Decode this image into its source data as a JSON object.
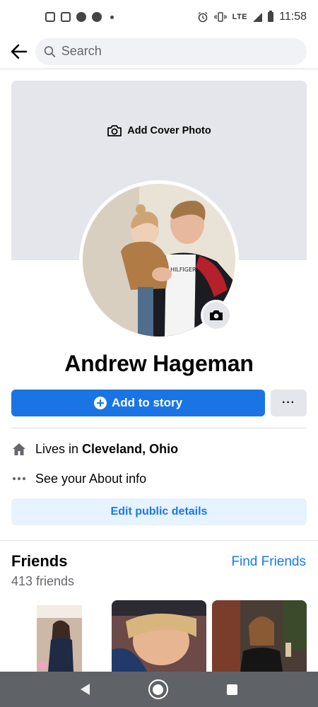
{
  "status_bar": {
    "network": "LTE",
    "time": "11:58"
  },
  "header": {
    "search_placeholder": "Search"
  },
  "cover": {
    "add_cover_label": "Add Cover Photo"
  },
  "profile": {
    "name": "Andrew Hageman"
  },
  "actions": {
    "add_story_label": "Add to story",
    "more_label": "···"
  },
  "about": {
    "lives_in_prefix": "Lives in",
    "lives_in_city": "Cleveland, Ohio",
    "see_about": "See your About info",
    "edit_details": "Edit public details"
  },
  "friends": {
    "title": "Friends",
    "find_link": "Find Friends",
    "count": "413 friends"
  },
  "colors": {
    "primary_blue": "#1b74e4",
    "link_blue": "#1877f2",
    "light_blue_bg": "#e7f3ff",
    "gray_bg": "#e4e6eb"
  }
}
